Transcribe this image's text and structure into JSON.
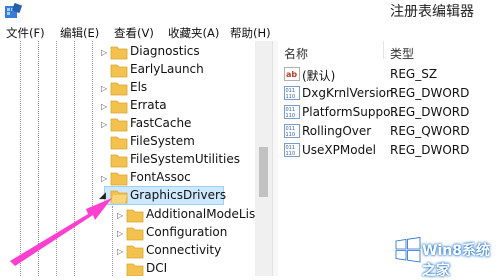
{
  "window": {
    "title": "注册表编辑器"
  },
  "menu": [
    "文件(F)",
    "编辑(E)",
    "查看(V)",
    "收藏夹(A)",
    "帮助(H)"
  ],
  "tree": {
    "items": [
      {
        "label": "Diagnostics"
      },
      {
        "label": "EarlyLaunch"
      },
      {
        "label": "Els"
      },
      {
        "label": "Errata"
      },
      {
        "label": "FastCache"
      },
      {
        "label": "FileSystem"
      },
      {
        "label": "FileSystemUtilities"
      },
      {
        "label": "FontAssoc"
      },
      {
        "label": "GraphicsDrivers",
        "selected": true,
        "expanded": true
      },
      {
        "label": "AdditionalModeLists"
      },
      {
        "label": "Configuration"
      },
      {
        "label": "Connectivity"
      },
      {
        "label": "DCI"
      }
    ]
  },
  "list": {
    "headers": {
      "name": "名称",
      "type": "类型"
    },
    "rows": [
      {
        "name": "(默认)",
        "type": "REG_SZ",
        "icon": "string-value-icon"
      },
      {
        "name": "DxgKrnlVersion",
        "type": "REG_DWORD",
        "icon": "binary-value-icon"
      },
      {
        "name": "PlatformSuppo...",
        "type": "REG_DWORD",
        "icon": "binary-value-icon"
      },
      {
        "name": "RollingOver",
        "type": "REG_QWORD",
        "icon": "binary-value-icon"
      },
      {
        "name": "UseXPModel",
        "type": "REG_DWORD",
        "icon": "binary-value-icon"
      }
    ]
  },
  "watermark": {
    "text": "Win8系统之家"
  },
  "colors": {
    "arrow": "#ff3fd0",
    "folder": "#f2c14e",
    "selection": "#cde8ff"
  }
}
